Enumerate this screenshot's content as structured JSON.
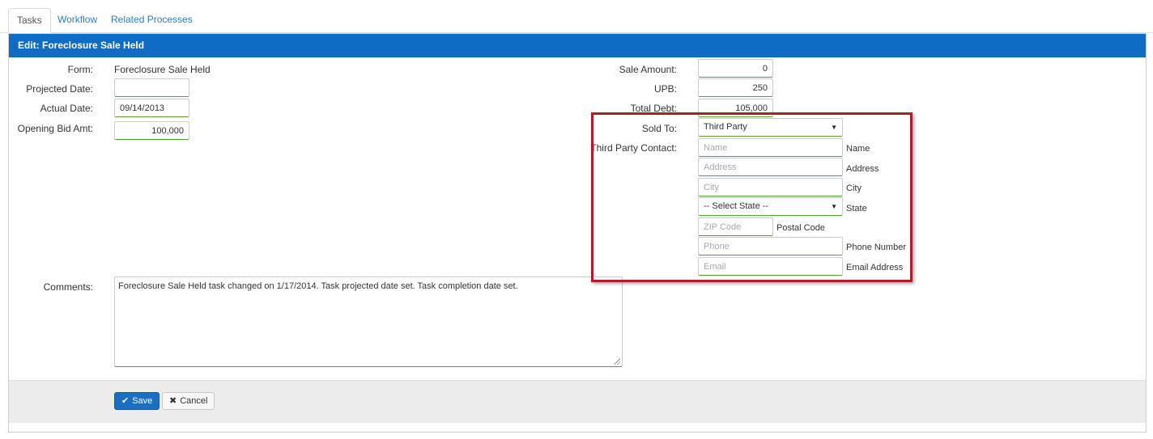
{
  "tabs": [
    {
      "label": "Tasks",
      "active": true
    },
    {
      "label": "Workflow",
      "active": false
    },
    {
      "label": "Related Processes",
      "active": false
    }
  ],
  "panel": {
    "title": "Edit: Foreclosure Sale Held"
  },
  "left_form": {
    "form_label": "Form:",
    "form_value": "Foreclosure Sale Held",
    "projected_date_label": "Projected Date:",
    "projected_date_value": "",
    "actual_date_label": "Actual Date:",
    "actual_date_value": "09/14/2013",
    "opening_bid_label": "Opening Bid Amt:",
    "opening_bid_value": "100,000"
  },
  "right_form": {
    "sale_amount_label": "Sale Amount:",
    "sale_amount_value": "0",
    "upb_label": "UPB:",
    "upb_value": "250",
    "total_debt_label": "Total Debt:",
    "total_debt_value": "105,000",
    "sold_to_label": "Sold To:",
    "sold_to_value": "Third Party",
    "third_party_contact_label": "Third Party Contact:",
    "contact": {
      "name_placeholder": "Name",
      "name_label": "Name",
      "address_placeholder": "Address",
      "address_label": "Address",
      "city_placeholder": "City",
      "city_label": "City",
      "state_value": "-- Select State --",
      "state_label": "State",
      "zip_placeholder": "ZIP Code",
      "zip_label": "Postal Code",
      "phone_placeholder": "Phone",
      "phone_label": "Phone Number",
      "email_placeholder": "Email",
      "email_label": "Email Address"
    }
  },
  "comments": {
    "label": "Comments:",
    "value": "Foreclosure Sale Held task changed on 1/17/2014. Task projected date set. Task completion date set."
  },
  "footer": {
    "save_label": "Save",
    "cancel_label": "Cancel"
  },
  "icons": {
    "save": "check-icon",
    "cancel": "x-icon",
    "dropdown": "caret-down-icon"
  },
  "colors": {
    "header_blue": "#0f6cc4",
    "highlight_red": "#b01e23",
    "input_green": "#5aa02c",
    "link_blue": "#2a7dc2"
  }
}
